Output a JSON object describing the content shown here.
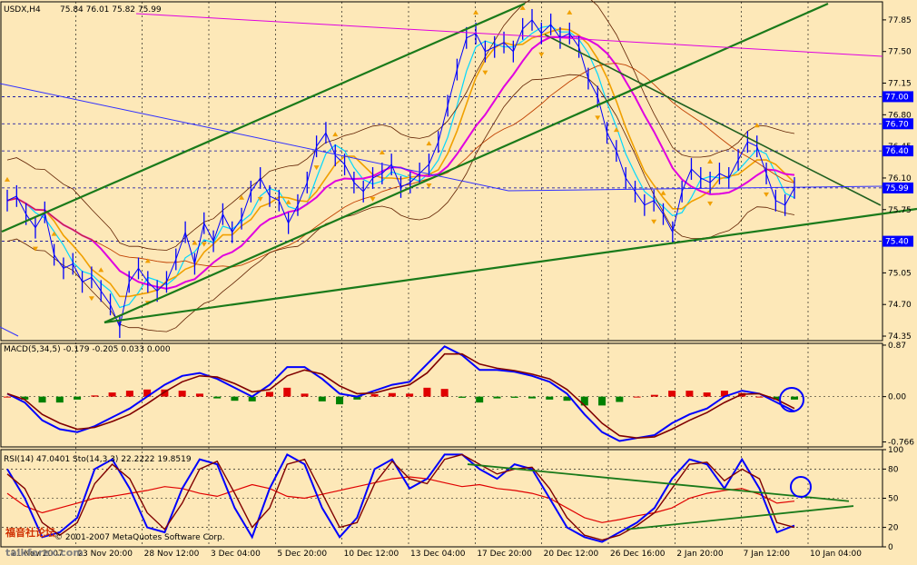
{
  "app": {
    "copyright": "© 2001-2007 MetaQuotes Software Corp.",
    "watermark_cn": "福音社论坛",
    "watermark_site": "talkforex.com"
  },
  "colors": {
    "background": "#fde8b8",
    "price_bars": "#0000ff",
    "macd_line": "#0000ff",
    "signal_line": "#800000",
    "histogram_up": "#e00000",
    "histogram_down": "#008000",
    "rsi_line": "#e00000",
    "stoch_main": "#0000ff",
    "stoch_signal": "#800000",
    "trendline": "#1a7a1a",
    "ema_magenta": "#e000e0",
    "ma_orange": "#f0a000",
    "ma_cyan": "#00d8ff",
    "bollinger": "#602000",
    "fractal_arrow": "#f0a000",
    "marker_circle": "#0000ff",
    "price_tag": "#0000ff"
  },
  "chart_data": [
    {
      "type": "line",
      "title": "USDX,H4",
      "ohlc": {
        "open": 75.84,
        "high": 76.01,
        "low": 75.82,
        "close": 75.99
      },
      "x_ticks": [
        "21 Nov 2007",
        "23 Nov 20:00",
        "28 Nov 12:00",
        "3 Dec 04:00",
        "5 Dec 20:00",
        "10 Dec 12:00",
        "13 Dec 04:00",
        "17 Dec 20:00",
        "20 Dec 12:00",
        "26 Dec 16:00",
        "2 Jan 20:00",
        "7 Jan 12:00",
        "10 Jan 04:00"
      ],
      "y_ticks": [
        77.85,
        77.5,
        77.15,
        76.8,
        76.45,
        76.1,
        75.75,
        75.05,
        74.7,
        74.35
      ],
      "ylim": [
        74.3,
        78.05
      ],
      "price_tags": [
        77.0,
        76.7,
        76.4,
        75.99,
        75.4
      ],
      "grid": true,
      "series": [
        {
          "values": [
            75.85,
            75.9,
            75.7,
            75.55,
            75.72,
            75.25,
            75.1,
            75.15,
            74.95,
            75.0,
            74.85,
            74.7,
            74.45,
            74.95,
            75.1,
            74.95,
            74.85,
            74.95,
            75.2,
            75.5,
            75.15,
            75.6,
            75.4,
            75.7,
            75.5,
            75.65,
            75.95,
            76.1,
            75.9,
            75.85,
            75.6,
            75.8,
            76.05,
            76.45,
            76.6,
            76.35,
            76.25,
            76.05,
            75.95,
            76.1,
            76.15,
            76.25,
            76.0,
            76.05,
            76.15,
            76.25,
            76.5,
            76.9,
            77.3,
            77.65,
            77.7,
            77.5,
            77.55,
            77.6,
            77.5,
            77.75,
            77.85,
            77.7,
            77.8,
            77.65,
            77.7,
            77.55,
            77.2,
            77.0,
            76.6,
            76.4,
            76.1,
            75.95,
            75.8,
            75.85,
            75.7,
            75.5,
            75.95,
            76.2,
            76.1,
            76.05,
            76.15,
            76.1,
            76.3,
            76.5,
            76.45,
            76.15,
            75.85,
            75.8,
            75.99
          ],
          "x_range": [
            0,
            84
          ]
        }
      ],
      "annotations": [
        "green ascending channel",
        "green descending trendline",
        "magenta moving average",
        "Bollinger bands",
        "fractal arrows"
      ]
    },
    {
      "type": "bar",
      "title": "MACD(5,34,5) -0.179 -0.205 0.033 0.000",
      "y_ticks": [
        0.87,
        0.0,
        -0.766
      ],
      "ylim": [
        -0.85,
        0.9
      ],
      "series": [
        {
          "name": "MACD",
          "values": [
            0.05,
            -0.1,
            -0.4,
            -0.55,
            -0.6,
            -0.5,
            -0.35,
            -0.2,
            0.0,
            0.2,
            0.35,
            0.4,
            0.3,
            0.15,
            0.0,
            0.2,
            0.5,
            0.5,
            0.3,
            0.05,
            0.0,
            0.1,
            0.2,
            0.25,
            0.55,
            0.85,
            0.7,
            0.45,
            0.45,
            0.42,
            0.35,
            0.25,
            0.05,
            -0.3,
            -0.6,
            -0.75,
            -0.7,
            -0.65,
            -0.45,
            -0.3,
            -0.2,
            0.0,
            0.1,
            0.05,
            -0.1,
            -0.25
          ]
        },
        {
          "name": "Signal",
          "values": [
            0.05,
            -0.05,
            -0.3,
            -0.45,
            -0.55,
            -0.52,
            -0.42,
            -0.3,
            -0.12,
            0.08,
            0.25,
            0.35,
            0.33,
            0.22,
            0.08,
            0.12,
            0.35,
            0.45,
            0.38,
            0.18,
            0.05,
            0.06,
            0.14,
            0.2,
            0.4,
            0.72,
            0.72,
            0.55,
            0.48,
            0.44,
            0.38,
            0.3,
            0.12,
            -0.15,
            -0.45,
            -0.66,
            -0.7,
            -0.68,
            -0.55,
            -0.4,
            -0.27,
            -0.1,
            0.04,
            0.05,
            -0.05,
            -0.2
          ]
        },
        {
          "name": "Histogram",
          "values": [
            0.0,
            -0.05,
            -0.1,
            -0.1,
            -0.05,
            0.02,
            0.07,
            0.1,
            0.12,
            0.12,
            0.1,
            0.05,
            -0.03,
            -0.07,
            -0.08,
            0.08,
            0.15,
            0.05,
            -0.08,
            -0.13,
            -0.05,
            0.04,
            0.06,
            0.05,
            0.15,
            0.13,
            -0.02,
            -0.1,
            -0.03,
            -0.02,
            -0.03,
            -0.05,
            -0.07,
            -0.15,
            -0.15,
            -0.09,
            0.0,
            0.03,
            0.1,
            0.1,
            0.07,
            0.1,
            0.06,
            0.0,
            -0.05,
            -0.05
          ]
        }
      ]
    },
    {
      "type": "line",
      "title": "RSI(14) 47.0401  Sto(14,3,3) 22.2222 19.8519",
      "y_ticks": [
        100,
        80,
        50,
        20,
        0
      ],
      "ylim": [
        0,
        100
      ],
      "series": [
        {
          "name": "RSI(14)",
          "values": [
            55,
            42,
            35,
            40,
            45,
            50,
            52,
            55,
            58,
            62,
            60,
            55,
            52,
            58,
            64,
            60,
            52,
            50,
            54,
            58,
            62,
            66,
            70,
            72,
            70,
            66,
            62,
            64,
            60,
            58,
            55,
            50,
            40,
            30,
            25,
            28,
            32,
            35,
            40,
            50,
            55,
            58,
            60,
            54,
            45,
            47
          ]
        },
        {
          "name": "Sto main",
          "values": [
            80,
            50,
            10,
            15,
            30,
            80,
            90,
            60,
            20,
            15,
            60,
            90,
            85,
            40,
            10,
            60,
            95,
            85,
            40,
            10,
            30,
            80,
            90,
            60,
            70,
            95,
            95,
            80,
            70,
            85,
            80,
            50,
            20,
            10,
            5,
            15,
            25,
            40,
            70,
            90,
            85,
            60,
            90,
            60,
            15,
            22
          ]
        },
        {
          "name": "Sto signal",
          "values": [
            75,
            60,
            25,
            12,
            25,
            65,
            85,
            70,
            35,
            18,
            45,
            80,
            88,
            55,
            20,
            40,
            85,
            90,
            55,
            20,
            25,
            65,
            88,
            70,
            65,
            90,
            95,
            85,
            75,
            80,
            82,
            60,
            30,
            12,
            7,
            12,
            22,
            35,
            60,
            85,
            87,
            68,
            80,
            70,
            25,
            20
          ]
        }
      ]
    }
  ]
}
